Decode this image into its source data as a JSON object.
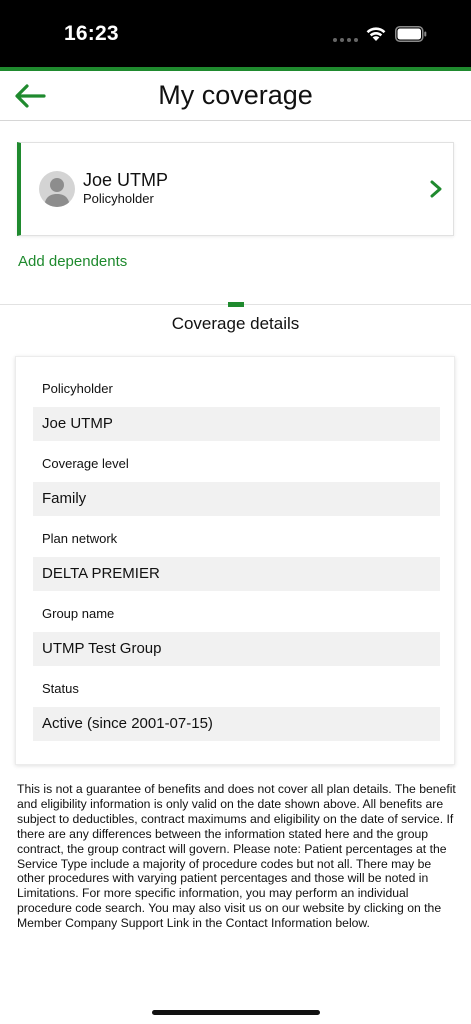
{
  "status_bar": {
    "time": "16:23"
  },
  "header": {
    "title": "My coverage"
  },
  "member": {
    "name": "Joe UTMP",
    "role": "Policyholder"
  },
  "add_dependents_label": "Add dependents",
  "section": {
    "title": "Coverage details"
  },
  "details": [
    {
      "label": "Policyholder",
      "value": "Joe UTMP"
    },
    {
      "label": "Coverage level",
      "value": "Family"
    },
    {
      "label": "Plan network",
      "value": "DELTA PREMIER"
    },
    {
      "label": "Group name",
      "value": "UTMP Test Group"
    },
    {
      "label": "Status",
      "value": "Active (since 2001-07-15)"
    }
  ],
  "disclaimer": "This is not a guarantee of benefits and does not cover all plan details. The benefit and eligibility information is only valid on the date shown above. All benefits are subject to deductibles, contract maximums and eligibility on the date of service. If there are any differences between the information stated here and the group contract, the group contract will govern. Please note: Patient percentages at the Service Type include a majority of procedure codes but not all. There may be other procedures with varying patient percentages and those will be noted in Limitations. For more specific information, you may perform an individual procedure code search.  You may also visit us on our website by clicking on the Member Company Support Link in the Contact Information below.",
  "colors": {
    "accent": "#1f8a2e",
    "field_background": "#f1f1f1",
    "status_bar": "#000000"
  },
  "icons": [
    "back-arrow-icon",
    "person-icon",
    "chevron-right-icon",
    "wifi-icon",
    "battery-icon"
  ]
}
